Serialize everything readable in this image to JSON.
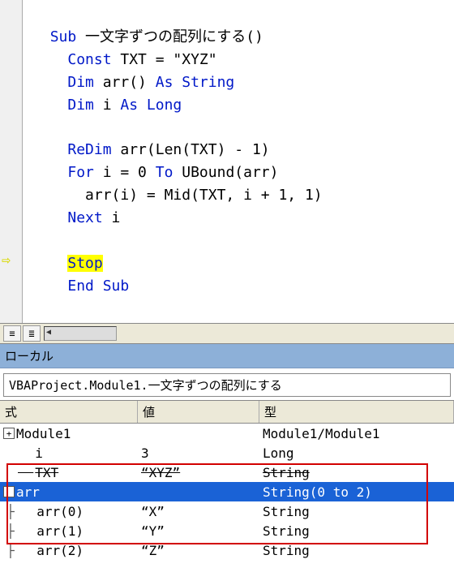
{
  "code": {
    "sub_kw": "Sub",
    "sub_name": " 一文字ずつの配列にする()",
    "const_kw": "Const",
    "const_body": " TXT = \"XYZ\"",
    "dim1_kw": "Dim",
    "dim1_mid": " arr() ",
    "dim1_as": "As String",
    "dim2_kw": "Dim",
    "dim2_mid": " i ",
    "dim2_as": "As Long",
    "redim_kw": "ReDim",
    "redim_body": " arr(Len(TXT) - 1)",
    "for_kw": "For",
    "for_mid": " i = 0 ",
    "for_to": "To",
    "for_end": " UBound(arr)",
    "body_line": "  arr(i) = Mid(TXT, i + 1, 1)",
    "next_kw": "Next",
    "next_var": " i",
    "stop_kw": "Stop",
    "end_kw": "End Sub"
  },
  "locals_panel": {
    "title": "ローカル",
    "context": "VBAProject.Module1.一文字ずつの配列にする",
    "headers": {
      "expr": "式",
      "value": "値",
      "type": "型"
    },
    "rows": [
      {
        "icon": "plus",
        "indent": 0,
        "name": "Module1",
        "value": "",
        "type": "Module1/Module1",
        "strike": false,
        "selected": false
      },
      {
        "icon": "",
        "indent": 1,
        "name": "i",
        "value": "3",
        "type": "Long",
        "strike": false,
        "selected": false
      },
      {
        "icon": "",
        "indent": 1,
        "name": "TXT",
        "value": "“XYZ”",
        "type": "String",
        "strike": true,
        "selected": false
      },
      {
        "icon": "minus",
        "indent": 0,
        "name": "arr",
        "value": "",
        "type": "String(0 to 2)",
        "strike": false,
        "selected": true
      },
      {
        "icon": "tree",
        "indent": 1,
        "name": "arr(0)",
        "value": "“X”",
        "type": "String",
        "strike": false,
        "selected": false
      },
      {
        "icon": "tree",
        "indent": 1,
        "name": "arr(1)",
        "value": "“Y”",
        "type": "String",
        "strike": false,
        "selected": false
      },
      {
        "icon": "tree",
        "indent": 1,
        "name": "arr(2)",
        "value": "“Z”",
        "type": "String",
        "strike": false,
        "selected": false
      }
    ]
  },
  "chart_data": {
    "type": "table",
    "title": "Locals window",
    "columns": [
      "式",
      "値",
      "型"
    ],
    "rows": [
      [
        "Module1",
        "",
        "Module1/Module1"
      ],
      [
        "i",
        "3",
        "Long"
      ],
      [
        "TXT",
        "“XYZ”",
        "String"
      ],
      [
        "arr",
        "",
        "String(0 to 2)"
      ],
      [
        "arr(0)",
        "“X”",
        "String"
      ],
      [
        "arr(1)",
        "“Y”",
        "String"
      ],
      [
        "arr(2)",
        "“Z”",
        "String"
      ]
    ]
  }
}
